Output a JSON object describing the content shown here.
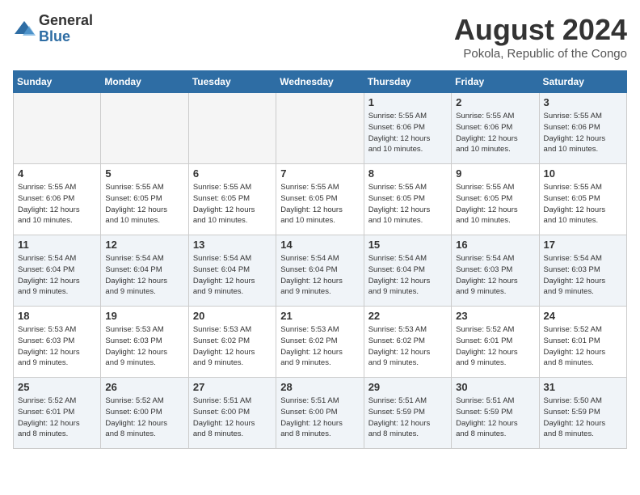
{
  "header": {
    "logo_general": "General",
    "logo_blue": "Blue",
    "month_year": "August 2024",
    "location": "Pokola, Republic of the Congo"
  },
  "weekdays": [
    "Sunday",
    "Monday",
    "Tuesday",
    "Wednesday",
    "Thursday",
    "Friday",
    "Saturday"
  ],
  "weeks": [
    [
      {
        "day": "",
        "info": "",
        "empty": true
      },
      {
        "day": "",
        "info": "",
        "empty": true
      },
      {
        "day": "",
        "info": "",
        "empty": true
      },
      {
        "day": "",
        "info": "",
        "empty": true
      },
      {
        "day": "1",
        "info": "Sunrise: 5:55 AM\nSunset: 6:06 PM\nDaylight: 12 hours\nand 10 minutes.",
        "empty": false
      },
      {
        "day": "2",
        "info": "Sunrise: 5:55 AM\nSunset: 6:06 PM\nDaylight: 12 hours\nand 10 minutes.",
        "empty": false
      },
      {
        "day": "3",
        "info": "Sunrise: 5:55 AM\nSunset: 6:06 PM\nDaylight: 12 hours\nand 10 minutes.",
        "empty": false
      }
    ],
    [
      {
        "day": "4",
        "info": "Sunrise: 5:55 AM\nSunset: 6:06 PM\nDaylight: 12 hours\nand 10 minutes.",
        "empty": false
      },
      {
        "day": "5",
        "info": "Sunrise: 5:55 AM\nSunset: 6:05 PM\nDaylight: 12 hours\nand 10 minutes.",
        "empty": false
      },
      {
        "day": "6",
        "info": "Sunrise: 5:55 AM\nSunset: 6:05 PM\nDaylight: 12 hours\nand 10 minutes.",
        "empty": false
      },
      {
        "day": "7",
        "info": "Sunrise: 5:55 AM\nSunset: 6:05 PM\nDaylight: 12 hours\nand 10 minutes.",
        "empty": false
      },
      {
        "day": "8",
        "info": "Sunrise: 5:55 AM\nSunset: 6:05 PM\nDaylight: 12 hours\nand 10 minutes.",
        "empty": false
      },
      {
        "day": "9",
        "info": "Sunrise: 5:55 AM\nSunset: 6:05 PM\nDaylight: 12 hours\nand 10 minutes.",
        "empty": false
      },
      {
        "day": "10",
        "info": "Sunrise: 5:55 AM\nSunset: 6:05 PM\nDaylight: 12 hours\nand 10 minutes.",
        "empty": false
      }
    ],
    [
      {
        "day": "11",
        "info": "Sunrise: 5:54 AM\nSunset: 6:04 PM\nDaylight: 12 hours\nand 9 minutes.",
        "empty": false
      },
      {
        "day": "12",
        "info": "Sunrise: 5:54 AM\nSunset: 6:04 PM\nDaylight: 12 hours\nand 9 minutes.",
        "empty": false
      },
      {
        "day": "13",
        "info": "Sunrise: 5:54 AM\nSunset: 6:04 PM\nDaylight: 12 hours\nand 9 minutes.",
        "empty": false
      },
      {
        "day": "14",
        "info": "Sunrise: 5:54 AM\nSunset: 6:04 PM\nDaylight: 12 hours\nand 9 minutes.",
        "empty": false
      },
      {
        "day": "15",
        "info": "Sunrise: 5:54 AM\nSunset: 6:04 PM\nDaylight: 12 hours\nand 9 minutes.",
        "empty": false
      },
      {
        "day": "16",
        "info": "Sunrise: 5:54 AM\nSunset: 6:03 PM\nDaylight: 12 hours\nand 9 minutes.",
        "empty": false
      },
      {
        "day": "17",
        "info": "Sunrise: 5:54 AM\nSunset: 6:03 PM\nDaylight: 12 hours\nand 9 minutes.",
        "empty": false
      }
    ],
    [
      {
        "day": "18",
        "info": "Sunrise: 5:53 AM\nSunset: 6:03 PM\nDaylight: 12 hours\nand 9 minutes.",
        "empty": false
      },
      {
        "day": "19",
        "info": "Sunrise: 5:53 AM\nSunset: 6:03 PM\nDaylight: 12 hours\nand 9 minutes.",
        "empty": false
      },
      {
        "day": "20",
        "info": "Sunrise: 5:53 AM\nSunset: 6:02 PM\nDaylight: 12 hours\nand 9 minutes.",
        "empty": false
      },
      {
        "day": "21",
        "info": "Sunrise: 5:53 AM\nSunset: 6:02 PM\nDaylight: 12 hours\nand 9 minutes.",
        "empty": false
      },
      {
        "day": "22",
        "info": "Sunrise: 5:53 AM\nSunset: 6:02 PM\nDaylight: 12 hours\nand 9 minutes.",
        "empty": false
      },
      {
        "day": "23",
        "info": "Sunrise: 5:52 AM\nSunset: 6:01 PM\nDaylight: 12 hours\nand 9 minutes.",
        "empty": false
      },
      {
        "day": "24",
        "info": "Sunrise: 5:52 AM\nSunset: 6:01 PM\nDaylight: 12 hours\nand 8 minutes.",
        "empty": false
      }
    ],
    [
      {
        "day": "25",
        "info": "Sunrise: 5:52 AM\nSunset: 6:01 PM\nDaylight: 12 hours\nand 8 minutes.",
        "empty": false
      },
      {
        "day": "26",
        "info": "Sunrise: 5:52 AM\nSunset: 6:00 PM\nDaylight: 12 hours\nand 8 minutes.",
        "empty": false
      },
      {
        "day": "27",
        "info": "Sunrise: 5:51 AM\nSunset: 6:00 PM\nDaylight: 12 hours\nand 8 minutes.",
        "empty": false
      },
      {
        "day": "28",
        "info": "Sunrise: 5:51 AM\nSunset: 6:00 PM\nDaylight: 12 hours\nand 8 minutes.",
        "empty": false
      },
      {
        "day": "29",
        "info": "Sunrise: 5:51 AM\nSunset: 5:59 PM\nDaylight: 12 hours\nand 8 minutes.",
        "empty": false
      },
      {
        "day": "30",
        "info": "Sunrise: 5:51 AM\nSunset: 5:59 PM\nDaylight: 12 hours\nand 8 minutes.",
        "empty": false
      },
      {
        "day": "31",
        "info": "Sunrise: 5:50 AM\nSunset: 5:59 PM\nDaylight: 12 hours\nand 8 minutes.",
        "empty": false
      }
    ]
  ]
}
